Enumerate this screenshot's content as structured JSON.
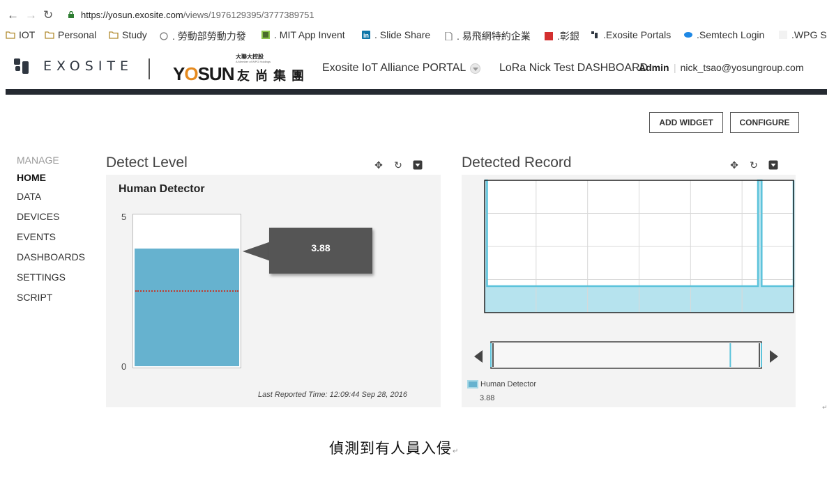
{
  "browser": {
    "url_scheme_host": "https://yosun.exosite.com",
    "url_path": "/views/1976129395/3777389751",
    "bookmarks": [
      {
        "label": "IOT",
        "icon": "folder-icon"
      },
      {
        "label": "Personal",
        "icon": "folder-icon"
      },
      {
        "label": "Study",
        "icon": "folder-icon"
      },
      {
        "label": ". 勞動部勞動力發",
        "icon": "agency-icon"
      },
      {
        "label": ". MIT App Invent",
        "icon": "appinventor-icon"
      },
      {
        "label": ". Slide Share",
        "icon": "linkedin-icon"
      },
      {
        "label": ". 易飛網特約企業",
        "icon": "page-icon"
      },
      {
        "label": ".彰銀",
        "icon": "bank-icon"
      },
      {
        "label": ".Exosite Portals",
        "icon": "exosite-icon"
      },
      {
        "label": ".Semtech Login",
        "icon": "semtech-icon"
      },
      {
        "label": ".WPG S",
        "icon": "blank-icon"
      }
    ]
  },
  "header": {
    "brand": "EXOSITE",
    "partner_brand": "YOSUN",
    "partner_brand_cn": "友尚集團",
    "partner_top": "大聯大控股",
    "partner_small": "A Member of WPG Holdings",
    "portal_name": "Exosite IoT Alliance PORTAL",
    "dashboard_name": "LoRa Nick Test DASHBOARD",
    "role": "Admin",
    "email": "nick_tsao@yosungroup.com",
    "bar_color": "#252a31"
  },
  "toolbar": {
    "add_widget": "ADD WIDGET",
    "configure": "CONFIGURE"
  },
  "sidebar": {
    "heading": "MANAGE",
    "items": [
      "HOME",
      "DATA",
      "DEVICES",
      "EVENTS",
      "DASHBOARDS",
      "SETTINGS",
      "SCRIPT"
    ],
    "active": "HOME"
  },
  "widgets": {
    "detect_level": {
      "title": "Detect Level",
      "gauge_label": "Human Detector",
      "max": "5",
      "min": "0",
      "value": 3.88,
      "value_text": "3.88",
      "threshold": 2.5,
      "fill_color": "#66b2cf",
      "last_reported": "Last Reported Time: 12:09:44 Sep 28, 2016"
    },
    "detected_record": {
      "title": "Detected Record",
      "legend_label": "Human Detector",
      "legend_value": "3.88",
      "series_color": "#5cc3db",
      "area_color": "#b6e3ee"
    }
  },
  "chart_data": {
    "type": "area",
    "series": [
      {
        "name": "Human Detector",
        "values": [
          5,
          1,
          1,
          1,
          1,
          1,
          1,
          1,
          1,
          1,
          1,
          1,
          1,
          1,
          5,
          1,
          1,
          1,
          5
        ]
      }
    ],
    "x": [
      0,
      0.1,
      1,
      2,
      3,
      4,
      5,
      6,
      7,
      8,
      9,
      10,
      10.5,
      11,
      11.15,
      11.3,
      12,
      12.45,
      12.6
    ],
    "ylim": [
      0,
      5
    ],
    "grid": true,
    "legend": "bottom-left"
  },
  "caption": {
    "text": "偵測到有人員入侵",
    "mark": "↵"
  }
}
